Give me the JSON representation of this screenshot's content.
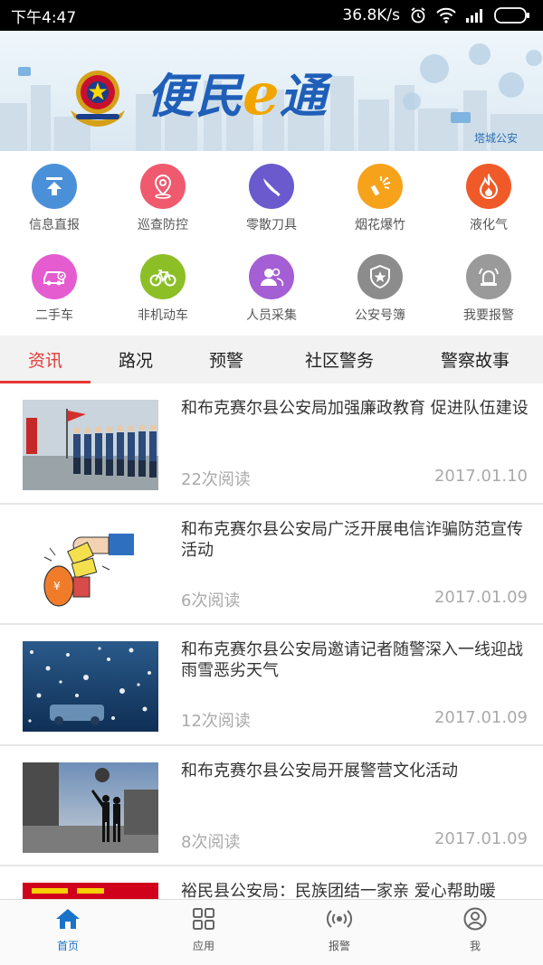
{
  "status_bar": {
    "time": "下午4:47",
    "net_speed": "36.8K/s",
    "icons": [
      "alarm-icon",
      "wifi-icon",
      "signal-icon",
      "battery-icon"
    ]
  },
  "banner": {
    "brand_pre": "便民",
    "brand_e": "e",
    "brand_post": "通",
    "subtitle": "塔城公安",
    "brand_color": "#1f5fb8",
    "accent_color": "#f2a500"
  },
  "services": [
    {
      "label": "信息直报",
      "icon": "upload-icon",
      "color": "#4a90d9"
    },
    {
      "label": "巡查防控",
      "icon": "location-pin-icon",
      "color": "#ef5a6f"
    },
    {
      "label": "零散刀具",
      "icon": "knife-icon",
      "color": "#6a5acd"
    },
    {
      "label": "烟花爆竹",
      "icon": "firework-icon",
      "color": "#f7a21b"
    },
    {
      "label": "液化气",
      "icon": "flame-icon",
      "color": "#f05a28"
    },
    {
      "label": "二手车",
      "icon": "car-icon",
      "color": "#e55bd0"
    },
    {
      "label": "非机动车",
      "icon": "bicycle-icon",
      "color": "#8cbf26"
    },
    {
      "label": "人员采集",
      "icon": "people-icon",
      "color": "#a45fd4"
    },
    {
      "label": "公安号簿",
      "icon": "police-badge-icon",
      "color": "#8c8c8c"
    },
    {
      "label": "我要报警",
      "icon": "alarm-bell-icon",
      "color": "#9a9a9a"
    }
  ],
  "tabs": [
    {
      "label": "资讯",
      "active": true
    },
    {
      "label": "路况",
      "active": false
    },
    {
      "label": "预警",
      "active": false
    },
    {
      "label": "社区警务",
      "active": false
    },
    {
      "label": "警察故事",
      "active": false
    }
  ],
  "news": [
    {
      "title": "和布克赛尔县公安局加强廉政教育 促进队伍建设",
      "reads": "22次阅读",
      "date": "2017.01.10",
      "thumb": "police-parade-photo"
    },
    {
      "title": "和布克赛尔县公安局广泛开展电信诈骗防范宣传活动",
      "reads": "6次阅读",
      "date": "2017.01.09",
      "thumb": "fraud-cartoon-image"
    },
    {
      "title": "和布克赛尔县公安局邀请记者随警深入一线迎战雨雪恶劣天气",
      "reads": "12次阅读",
      "date": "2017.01.09",
      "thumb": "snowstorm-photo"
    },
    {
      "title": "和布克赛尔县公安局开展警营文化活动",
      "reads": "8次阅读",
      "date": "2017.01.09",
      "thumb": "dance-silhouette-photo"
    },
    {
      "title": "裕民县公安局：民族团结一家亲 爱心帮助暖",
      "reads": "",
      "date": "",
      "thumb": "red-banner-photo"
    }
  ],
  "bottom_nav": [
    {
      "label": "首页",
      "icon": "home-icon",
      "active": true
    },
    {
      "label": "应用",
      "icon": "grid-apps-icon",
      "active": false
    },
    {
      "label": "报警",
      "icon": "broadcast-icon",
      "active": false
    },
    {
      "label": "我",
      "icon": "user-icon",
      "active": false
    }
  ]
}
